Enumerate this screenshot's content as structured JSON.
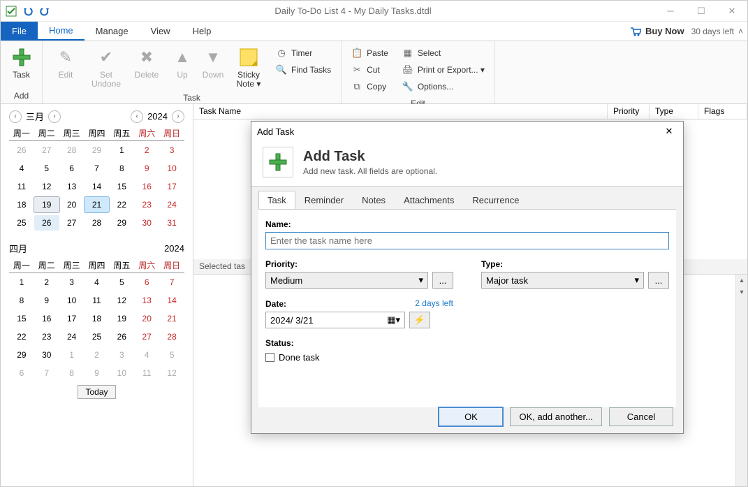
{
  "title": "Daily To-Do List 4 - My Daily Tasks.dtdl",
  "buy_now": "Buy Now",
  "days_left": "30 days left",
  "menu_tabs": {
    "file": "File",
    "home": "Home",
    "manage": "Manage",
    "view": "View",
    "help": "Help"
  },
  "ribbon": {
    "add": {
      "caption": "Add",
      "task": "Task"
    },
    "task_group": {
      "caption": "Task",
      "edit": "Edit",
      "set_undone": "Set\nUndone",
      "delete": "Delete",
      "up": "Up",
      "down": "Down",
      "sticky": "Sticky\nNote ▾",
      "timer": "Timer",
      "find": "Find Tasks"
    },
    "edit_group": {
      "caption": "Edit",
      "paste": "Paste",
      "cut": "Cut",
      "copy": "Copy",
      "select": "Select",
      "print": "Print or Export... ▾",
      "options": "Options..."
    }
  },
  "columns": {
    "task_name": "Task Name",
    "priority": "Priority",
    "type": "Type",
    "flags": "Flags"
  },
  "selected_tasks": "Selected tas",
  "calendar1": {
    "month": "三月",
    "year": "2024",
    "dow": [
      "周一",
      "周二",
      "周三",
      "周四",
      "周五",
      "周六",
      "周日"
    ],
    "cells": [
      {
        "d": "26",
        "c": "out"
      },
      {
        "d": "27",
        "c": "out"
      },
      {
        "d": "28",
        "c": "out"
      },
      {
        "d": "29",
        "c": "out"
      },
      {
        "d": "1"
      },
      {
        "d": "2",
        "c": "sat"
      },
      {
        "d": "3",
        "c": "sun"
      },
      {
        "d": "4"
      },
      {
        "d": "5"
      },
      {
        "d": "6"
      },
      {
        "d": "7"
      },
      {
        "d": "8"
      },
      {
        "d": "9",
        "c": "sat"
      },
      {
        "d": "10",
        "c": "sun"
      },
      {
        "d": "11"
      },
      {
        "d": "12"
      },
      {
        "d": "13"
      },
      {
        "d": "14"
      },
      {
        "d": "15"
      },
      {
        "d": "16",
        "c": "sat"
      },
      {
        "d": "17",
        "c": "sun"
      },
      {
        "d": "18"
      },
      {
        "d": "19",
        "c": "sel"
      },
      {
        "d": "20"
      },
      {
        "d": "21",
        "c": "today"
      },
      {
        "d": "22"
      },
      {
        "d": "23",
        "c": "sat"
      },
      {
        "d": "24",
        "c": "sun"
      },
      {
        "d": "25"
      },
      {
        "d": "26",
        "c": "sel2"
      },
      {
        "d": "27"
      },
      {
        "d": "28"
      },
      {
        "d": "29"
      },
      {
        "d": "30",
        "c": "sat"
      },
      {
        "d": "31",
        "c": "sun"
      }
    ]
  },
  "calendar2": {
    "month": "四月",
    "year": "2024",
    "dow": [
      "周一",
      "周二",
      "周三",
      "周四",
      "周五",
      "周六",
      "周日"
    ],
    "cells": [
      {
        "d": "1"
      },
      {
        "d": "2"
      },
      {
        "d": "3"
      },
      {
        "d": "4"
      },
      {
        "d": "5"
      },
      {
        "d": "6",
        "c": "sat"
      },
      {
        "d": "7",
        "c": "sun"
      },
      {
        "d": "8"
      },
      {
        "d": "9"
      },
      {
        "d": "10"
      },
      {
        "d": "11"
      },
      {
        "d": "12"
      },
      {
        "d": "13",
        "c": "sat"
      },
      {
        "d": "14",
        "c": "sun"
      },
      {
        "d": "15"
      },
      {
        "d": "16"
      },
      {
        "d": "17"
      },
      {
        "d": "18"
      },
      {
        "d": "19"
      },
      {
        "d": "20",
        "c": "sat"
      },
      {
        "d": "21",
        "c": "sun"
      },
      {
        "d": "22"
      },
      {
        "d": "23"
      },
      {
        "d": "24"
      },
      {
        "d": "25"
      },
      {
        "d": "26"
      },
      {
        "d": "27",
        "c": "sat"
      },
      {
        "d": "28",
        "c": "sun"
      },
      {
        "d": "29"
      },
      {
        "d": "30"
      },
      {
        "d": "1",
        "c": "out"
      },
      {
        "d": "2",
        "c": "out"
      },
      {
        "d": "3",
        "c": "out"
      },
      {
        "d": "4",
        "c": "out"
      },
      {
        "d": "5",
        "c": "out"
      },
      {
        "d": "6",
        "c": "out"
      },
      {
        "d": "7",
        "c": "out"
      },
      {
        "d": "8",
        "c": "out"
      },
      {
        "d": "9",
        "c": "out"
      },
      {
        "d": "10",
        "c": "out"
      },
      {
        "d": "11",
        "c": "out"
      },
      {
        "d": "12",
        "c": "out"
      }
    ]
  },
  "today_btn": "Today",
  "dialog": {
    "title": "Add Task",
    "heading": "Add Task",
    "sub": "Add new task. All fields are optional.",
    "tabs": [
      "Task",
      "Reminder",
      "Notes",
      "Attachments",
      "Recurrence"
    ],
    "name_label": "Name:",
    "name_placeholder": "Enter the task name here",
    "priority_label": "Priority:",
    "priority_value": "Medium",
    "type_label": "Type:",
    "type_value": "Major task",
    "date_label": "Date:",
    "date_value": "2024/  3/21",
    "days_left": "2 days left",
    "status_label": "Status:",
    "done_label": "Done task",
    "ok": "OK",
    "ok_another": "OK, add another...",
    "cancel": "Cancel",
    "dots": "..."
  }
}
